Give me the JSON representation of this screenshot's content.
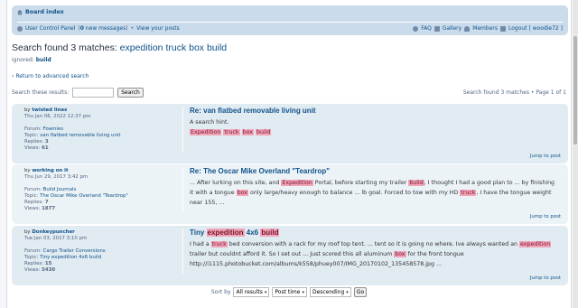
{
  "navbar": {
    "board_index": "Board index",
    "user_control_panel": "User Control Panel",
    "messages_count": "0",
    "messages_label": "new messages",
    "bullet": "•",
    "view_posts": "View your posts",
    "faq": "FAQ",
    "gallery": "Gallery",
    "members": "Members",
    "logout": "Logout [ woodie72 ]"
  },
  "search": {
    "heading_prefix": "Search found 3 matches: ",
    "heading_query": "expedition truck box build",
    "ignored_label": "ignored:",
    "ignored_word": "build",
    "advanced_link": "Return to advanced search",
    "search_results_label": "Search these results:",
    "search_button": "Search",
    "page_info": "Search found 3 matches • Page 1 of 1"
  },
  "results": [
    {
      "author": "twisted lines",
      "date": "Thu Jan 06, 2022 12:37 pm",
      "forum_label": "Forum:",
      "forum": "Foamies",
      "topic_label": "Topic:",
      "topic": "van flatbed removable living unit",
      "replies_label": "Replies:",
      "replies": "3",
      "views_label": "Views:",
      "views": "61",
      "title": "Re: van flatbed removable living unit",
      "content_text": "A search hint.",
      "tags": [
        "Expedition",
        "truck",
        "box",
        "build"
      ],
      "jump": "Jump to post"
    },
    {
      "author": "working on it",
      "date": "Thu Jun 29, 2017 3:42 pm",
      "forum_label": "Forum:",
      "forum": "Build Journals",
      "topic_label": "Topic:",
      "topic": "The Oscar Mike Overland \"Teardrop\"",
      "replies_label": "Replies:",
      "replies": "7",
      "views_label": "Views:",
      "views": "1877",
      "title": "Re: The Oscar Mike Overland \"Teardrop\"",
      "seg": [
        "... After lurking on this site, and ",
        "Expedition",
        " Portal, before starting my trailer ",
        "build",
        ", I thought I had a good plan to ... by finishing it with a tongue ",
        "box",
        " only large/heavy enough to balance ... lb goal. Forced to tow with my HD ",
        "truck",
        ", I have the tongue weight near 155, ..."
      ],
      "jump": "Jump to post"
    },
    {
      "author": "Donkeypuncher",
      "date": "Tue Jan 03, 2017 3:10 pm",
      "forum_label": "Forum:",
      "forum": "Cargo Trailer Conversions",
      "topic_label": "Topic:",
      "topic": "Tiny expedition 4x6 build",
      "replies_label": "Replies:",
      "replies": "15",
      "views_label": "Views:",
      "views": "5430",
      "title_seg": [
        "Tiny ",
        "expedition",
        " 4x6 ",
        "build"
      ],
      "seg": [
        "I had a ",
        "truck",
        " bed conversion with a rack for my roof top tent. ... tent so it is going no where. Ive always wanted an ",
        "expedition",
        " trailer but couldnt afford it. So I set out ... Just scored this all aluminum ",
        "box",
        " for the front tongue http://i1115.photobucket.com/albums/k558/phuey007/IMG_20170102_135458578.jpg ..."
      ],
      "jump": "Jump to post"
    }
  ],
  "sort": {
    "sort_by_label": "Sort by",
    "results_option": "All results",
    "time_option": "Post time",
    "order_option": "Descending",
    "go_button": "Go"
  },
  "icons": {
    "home": "home-icon",
    "ucp": "user-control-panel-icon",
    "faq": "faq-icon",
    "gallery": "gallery-icon",
    "members": "members-icon",
    "logout": "logout-icon",
    "back_arrow": "‹"
  },
  "colors": {
    "navbar_bg": "#cadceb",
    "post_bg": "#e1ebf2",
    "post_alt_bg": "#ecf3f7",
    "link": "#105289",
    "highlight": "#f1a5b8"
  }
}
